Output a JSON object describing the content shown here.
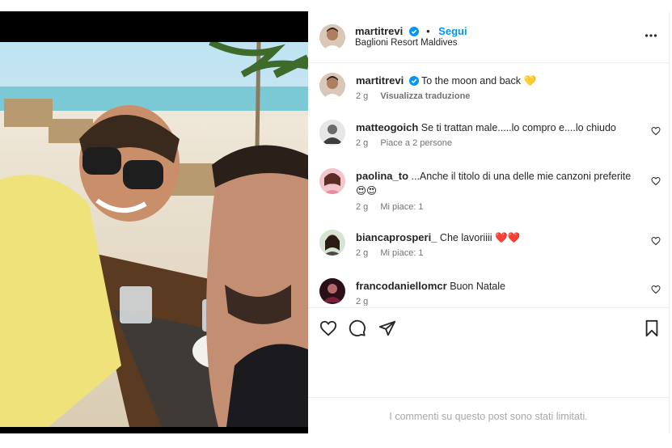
{
  "post": {
    "author": "martitrevi",
    "follow_label": "Segui",
    "separator": "•",
    "location": "Baglioni Resort Maldives"
  },
  "caption": {
    "author": "martitrevi",
    "text": "To the moon and back",
    "emoji": "💛",
    "time": "2 g",
    "translate_label": "Visualizza traduzione"
  },
  "comments": [
    {
      "author": "matteogoich",
      "text": "Se ti trattan male.....lo compro e....lo chiudo",
      "time": "2 g",
      "likes": "Piace a 2 persone"
    },
    {
      "author": "paolina_to",
      "text": "...Anche il titolo di una delle mie canzoni preferite",
      "text2": "😍😍",
      "time": "2 g",
      "likes": "Mi piace: 1"
    },
    {
      "author": "biancaprosperi_",
      "text": "Che lavoriiii ❤️❤️",
      "time": "2 g",
      "likes": "Mi piace: 1"
    },
    {
      "author": "francodaniellomcr",
      "text": "Buon Natale",
      "time": "2 g",
      "likes": ""
    }
  ],
  "footer": {
    "limited_text": "I commenti su questo post sono stati limitati."
  },
  "colors": {
    "accent": "#0095f6",
    "verified": "#0095f6",
    "muted": "#737373"
  }
}
